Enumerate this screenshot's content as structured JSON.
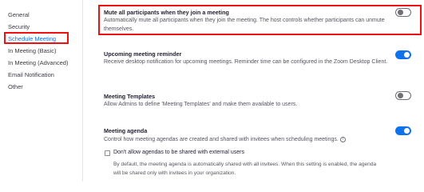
{
  "sidebar": {
    "items": [
      {
        "label": "General"
      },
      {
        "label": "Security"
      },
      {
        "label": "Schedule Meeting"
      },
      {
        "label": "In Meeting (Basic)"
      },
      {
        "label": "In Meeting (Advanced)"
      },
      {
        "label": "Email Notification"
      },
      {
        "label": "Other"
      }
    ],
    "active_index": 2
  },
  "settings": {
    "mute_participants": {
      "title": "Mute all participants when they join a meeting",
      "description": "Automatically mute all participants when they join the meeting. The host controls whether participants can unmute themselves.",
      "enabled": false
    },
    "meeting_reminder": {
      "title": "Upcoming meeting reminder",
      "description": "Receive desktop notification for upcoming meetings. Reminder time can be configured in the Zoom Desktop Client.",
      "enabled": true
    },
    "meeting_templates": {
      "title": "Meeting Templates",
      "description": "Allow Admins to define 'Meeting Templates' and make them available to users.",
      "enabled": false
    },
    "meeting_agenda": {
      "title": "Meeting agenda",
      "description": "Control how meeting agendas are created and shared with invitees when scheduling meetings.",
      "enabled": true,
      "external_share": {
        "label": "Don't allow agendas to be shared with external users",
        "checked": false,
        "description": "By default, the meeting agenda is automatically shared with all invitees. When this setting is enabled, the agenda will be shared only with invitees in your organization."
      }
    }
  },
  "colors": {
    "accent": "#0e72ed",
    "highlight": "#ee1111",
    "toggle_off": "#6e6e78"
  }
}
